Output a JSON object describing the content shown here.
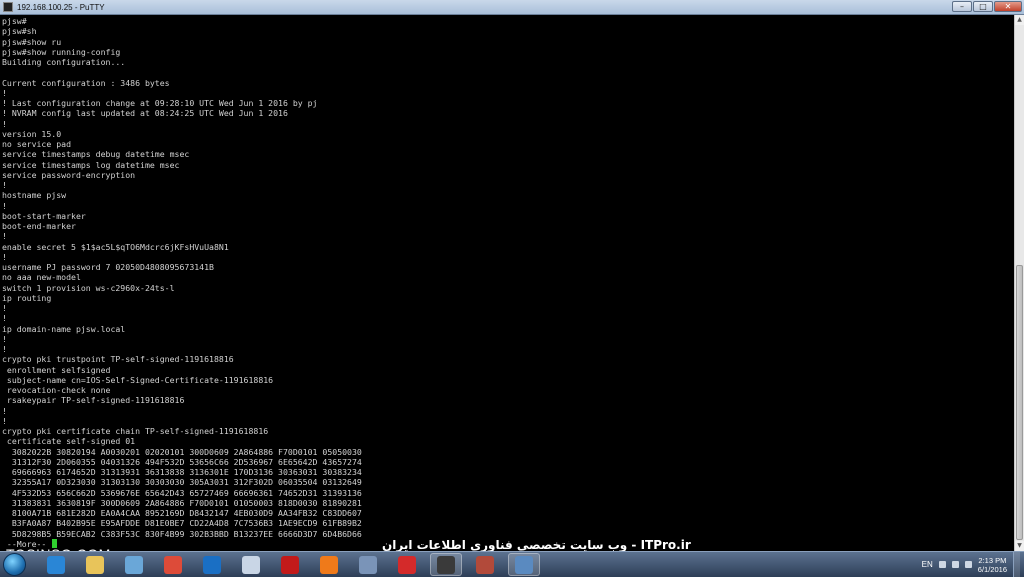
{
  "window": {
    "title": "192.168.100.25 - PuTTY",
    "minimize": "–",
    "maximize": "□",
    "close": "✕"
  },
  "terminal": {
    "lines": [
      "pjsw#",
      "pjsw#sh",
      "pjsw#show ru",
      "pjsw#show running-config",
      "Building configuration...",
      "",
      "Current configuration : 3486 bytes",
      "!",
      "! Last configuration change at 09:28:10 UTC Wed Jun 1 2016 by pj",
      "! NVRAM config last updated at 08:24:25 UTC Wed Jun 1 2016",
      "!",
      "version 15.0",
      "no service pad",
      "service timestamps debug datetime msec",
      "service timestamps log datetime msec",
      "service password-encryption",
      "!",
      "hostname pjsw",
      "!",
      "boot-start-marker",
      "boot-end-marker",
      "!",
      "enable secret 5 $1$ac5L$qTO6Mdcrc6jKFsHVuUa8N1",
      "!",
      "username PJ password 7 02050D4808095673141B",
      "no aaa new-model",
      "switch 1 provision ws-c2960x-24ts-l",
      "ip routing",
      "!",
      "!",
      "ip domain-name pjsw.local",
      "!",
      "!",
      "crypto pki trustpoint TP-self-signed-1191618816",
      " enrollment selfsigned",
      " subject-name cn=IOS-Self-Signed-Certificate-1191618816",
      " revocation-check none",
      " rsakeypair TP-self-signed-1191618816",
      "!",
      "!",
      "crypto pki certificate chain TP-self-signed-1191618816",
      " certificate self-signed 01",
      "  3082022B 30820194 A0030201 02020101 300D0609 2A864886 F70D0101 05050030",
      "  31312F30 2D060355 04031326 494F532D 53656C66 2D536967 6E65642D 43657274",
      "  69666963 6174652D 31313931 36313838 3136301E 170D3136 30363031 30383234",
      "  32355A17 0D323030 31303130 30303030 305A3031 312F302D 06035504 03132649",
      "  4F532D53 656C662D 5369676E 65642D43 65727469 66696361 74652D31 31393136",
      "  31383831 3630819F 300D0609 2A864886 F70D0101 01050003 818D0030 81890281",
      "  8100A71B 681E282D EA0A4CAA 8952169D D8432147 4EB030D9 AA34FB32 C83DD607",
      "  B3FA0A87 B402B95E E95AFDDE D81E0BE7 CD22A4D8 7C7536B3 1AE9ECD9 61FB89B2",
      "  5D8298B5 B59ECAB2 C383F53C 830F4B99 302B3BBD B13237EE 6666D3D7 6D4B6D66",
      " --More-- "
    ]
  },
  "watermarks": {
    "left": "TOSINSO.COM",
    "right": "ITPro.ir - وب سایت تخصصی فناوری اطلاعات ایران"
  },
  "taskbar": {
    "apps": [
      {
        "name": "internet-explorer",
        "color": "#2a86d6"
      },
      {
        "name": "file-explorer",
        "color": "#e8c45a"
      },
      {
        "name": "media-player",
        "color": "#6aa7d8"
      },
      {
        "name": "chrome",
        "color": "#dd4b39"
      },
      {
        "name": "outlook",
        "color": "#1a6fc4"
      },
      {
        "name": "notepad",
        "color": "#c9d6e6"
      },
      {
        "name": "kaspersky",
        "color": "#c21a1a"
      },
      {
        "name": "firefox",
        "color": "#ef7a1a"
      },
      {
        "name": "network-tool",
        "color": "#7a94b8"
      },
      {
        "name": "pdf-reader",
        "color": "#d42a2a"
      },
      {
        "name": "putty",
        "color": "#3a3a3a"
      },
      {
        "name": "archive-tool",
        "color": "#b24a3a"
      },
      {
        "name": "network-config",
        "color": "#5a8ac0"
      }
    ],
    "language": "EN",
    "time": "2:13 PM",
    "date": "6/1/2016"
  }
}
